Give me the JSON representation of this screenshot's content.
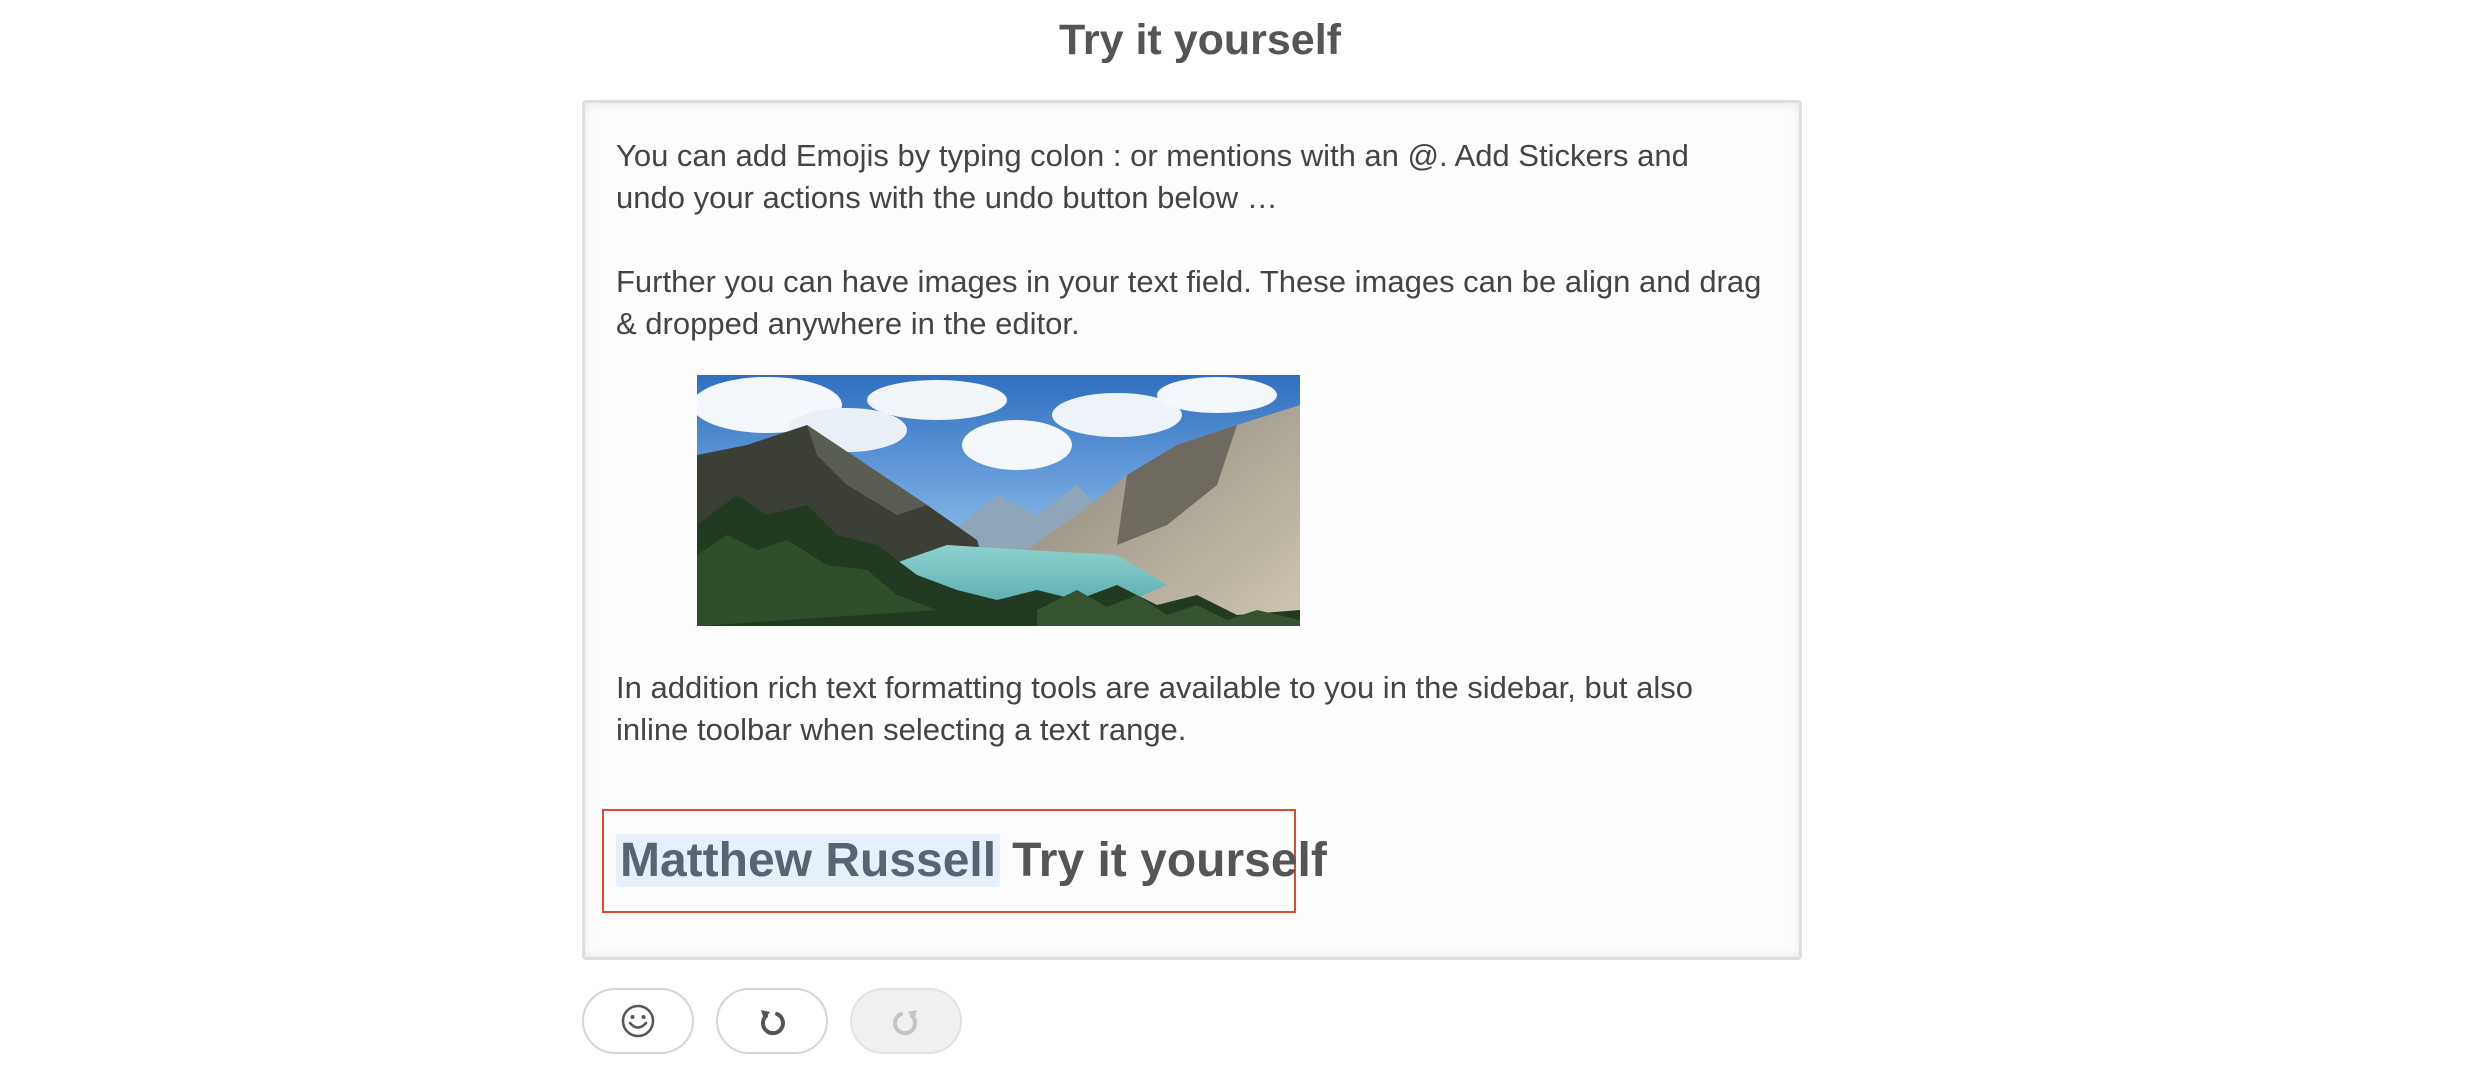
{
  "page": {
    "title": "Try it yourself"
  },
  "editor": {
    "paragraphs": [
      "You can add Emojis by typing colon : or mentions with an @. Add Stickers and undo your actions with the undo button below …",
      "Further you can have images in your text field. These images can be align and drag & dropped anywhere in the editor.",
      "In addition rich text formatting tools are available to you in the sidebar, but also inline toolbar when selecting a text range."
    ],
    "image": {
      "subject": "mountain-lake-landscape"
    },
    "heading": {
      "mention": "Matthew Russell",
      "text": "Try it yourself"
    }
  },
  "toolbar": {
    "buttons": [
      {
        "icon": "emoji-icon",
        "enabled": true
      },
      {
        "icon": "undo-icon",
        "enabled": true
      },
      {
        "icon": "redo-icon",
        "enabled": false
      }
    ]
  },
  "colors": {
    "selection_border": "#e04a2e",
    "mention_background": "#e6f0fb",
    "text": "#444444",
    "disabled_button": "#f0f0f0"
  }
}
